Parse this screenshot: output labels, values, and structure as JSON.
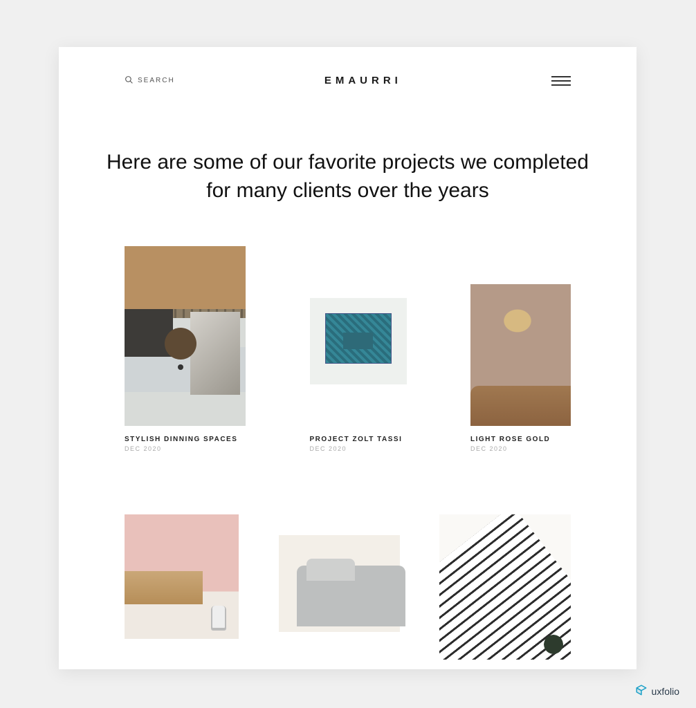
{
  "header": {
    "search_label": "SEARCH",
    "logo": "EMAURRI"
  },
  "hero": {
    "headline": "Here are some of our favorite projects we completed for many clients over the years"
  },
  "projects": [
    {
      "title": "STYLISH DINNING SPACES",
      "date": "DEC 2020"
    },
    {
      "title": "PROJECT ZOLT TASSI",
      "date": "DEC 2020"
    },
    {
      "title": "LIGHT ROSE GOLD",
      "date": "DEC 2020"
    }
  ],
  "badge": {
    "label": "uxfolio"
  }
}
